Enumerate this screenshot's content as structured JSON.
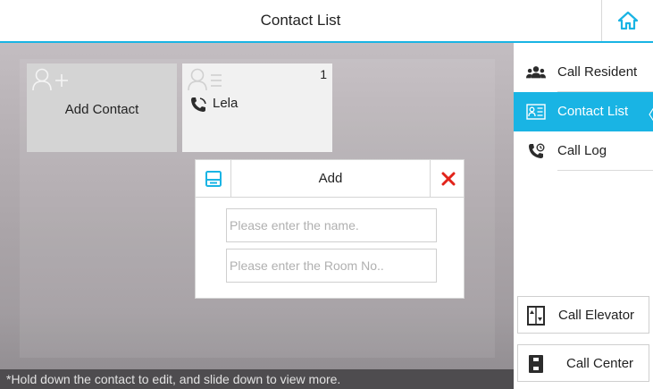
{
  "header": {
    "title": "Contact List",
    "home_icon": "home-icon"
  },
  "cards": {
    "add": {
      "label": "Add Contact",
      "icon": "add-person-icon"
    },
    "contact": {
      "name": "Lela",
      "count": "1",
      "icon": "contact-list-icon",
      "phone_icon": "phone-icon"
    }
  },
  "dialog": {
    "title": "Add",
    "save_icon": "save-icon",
    "close_icon": "close-icon",
    "name_placeholder": "Please enter the name.",
    "room_placeholder": "Please enter the Room No..",
    "name_value": "",
    "room_value": ""
  },
  "footer": {
    "hint": "*Hold down the contact to edit, and slide down to view more."
  },
  "sidebar": {
    "items": [
      {
        "label": "Call Resident",
        "icon": "residents-icon"
      },
      {
        "label": "Contact List",
        "icon": "contact-list-icon",
        "selected": true
      },
      {
        "label": "Call Log",
        "icon": "call-log-icon"
      }
    ],
    "call_elevator": {
      "label": "Call Elevator",
      "icon": "elevator-icon"
    },
    "call_center": {
      "label": "Call Center",
      "icon": "call-center-icon"
    }
  },
  "colors": {
    "accent": "#19b4e4",
    "close": "#e2231a",
    "selected_text": "#ffffff"
  }
}
